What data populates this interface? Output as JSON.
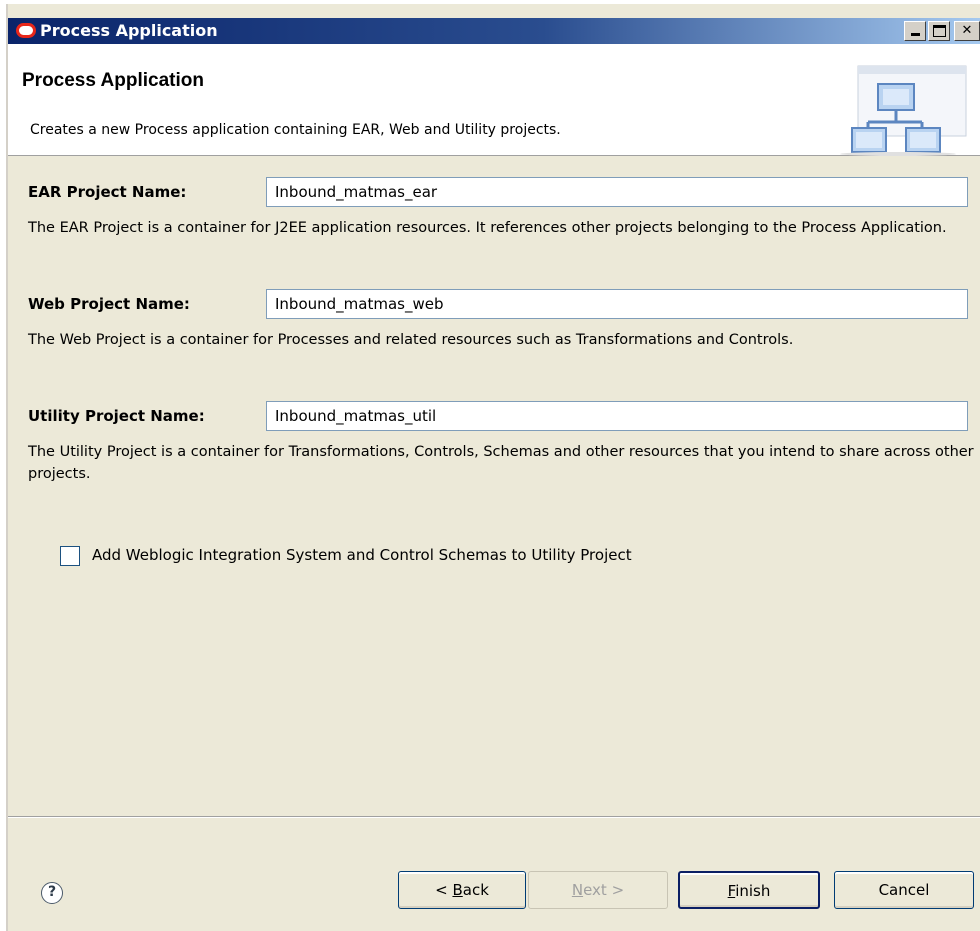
{
  "window": {
    "title": "Process Application"
  },
  "banner": {
    "title": "Process Application",
    "description": "Creates a new Process application containing EAR, Web and Utility projects."
  },
  "form": {
    "ear": {
      "label": "EAR Project Name:",
      "value": "Inbound_matmas_ear",
      "help": "The EAR Project is a container for J2EE application resources.  It references other projects belonging to the Process Application."
    },
    "web": {
      "label": "Web Project Name:",
      "value": "Inbound_matmas_web",
      "help": "The Web Project is a container for Processes and related resources such as Transformations and Controls."
    },
    "util": {
      "label": "Utility Project Name:",
      "value": "Inbound_matmas_util",
      "help": "The Utility Project is a container for Transformations, Controls, Schemas and other resources that you intend to share across other projects."
    },
    "schemas_checkbox": {
      "label": "Add Weblogic Integration System and Control Schemas to Utility Project",
      "checked": false
    }
  },
  "buttons": {
    "back_prefix": "< ",
    "back_mnemonic": "B",
    "back_rest": "ack",
    "next_mnemonic": "N",
    "next_rest": "ext >",
    "finish_mnemonic": "F",
    "finish_rest": "inish",
    "cancel": "Cancel",
    "help_symbol": "?"
  },
  "icons": {
    "app": "oracle-logo-icon",
    "banner": "project-hierarchy-icon",
    "help": "help-icon"
  },
  "colors": {
    "titlebar_start": "#0a246a",
    "titlebar_end": "#a6caf0",
    "dialog_bg": "#ece9d8",
    "oracle_red": "#e8271a"
  }
}
